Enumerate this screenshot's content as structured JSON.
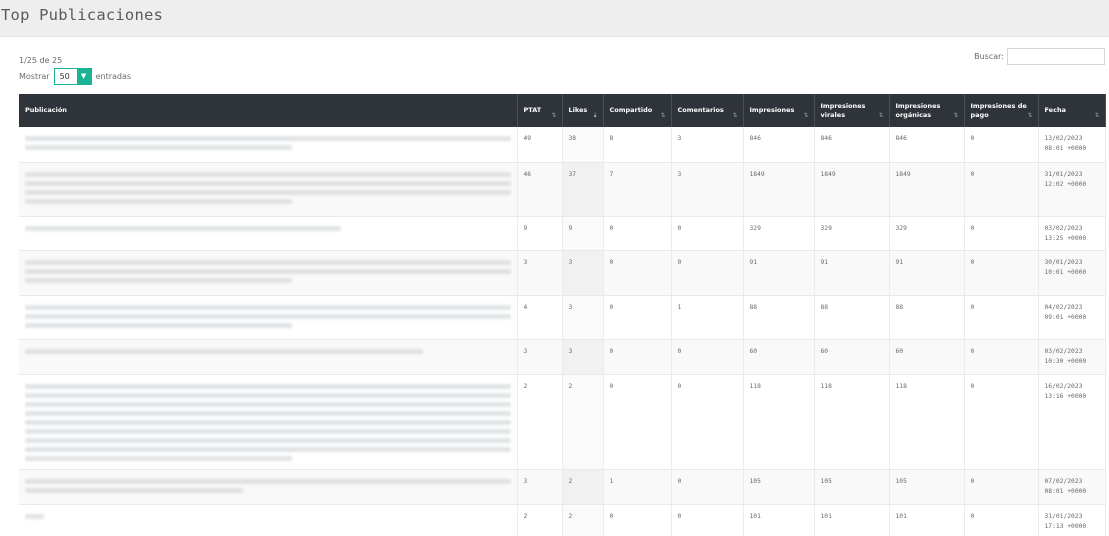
{
  "page": {
    "title": "Top Publicaciones"
  },
  "table_info": {
    "pagination_text": "1/25 de 25",
    "length_prefix": "Mostrar",
    "length_value": "50",
    "length_suffix": "entradas",
    "search_label": "Buscar:",
    "search_value": ""
  },
  "columns": [
    {
      "label": "Publicación",
      "sort": ""
    },
    {
      "label": "PTAT",
      "sort": "⇅"
    },
    {
      "label": "Likes",
      "sort": "⇣"
    },
    {
      "label": "Compartido",
      "sort": "⇅"
    },
    {
      "label": "Comentarios",
      "sort": "⇅"
    },
    {
      "label": "Impresiones",
      "sort": "⇅"
    },
    {
      "label": "Impresiones virales",
      "sort": "⇅"
    },
    {
      "label": "Impresiones orgánicas",
      "sort": "⇅"
    },
    {
      "label": "Impresiones de pago",
      "sort": "⇅"
    },
    {
      "label": "Fecha",
      "sort": "⇅"
    }
  ],
  "rows": [
    {
      "ptat": "49",
      "likes": "38",
      "shared": "8",
      "comments": "3",
      "impr": "846",
      "viral": "846",
      "organic": "846",
      "paid": "0",
      "date": "13/02/2023",
      "time": "08:01 +0000"
    },
    {
      "ptat": "46",
      "likes": "37",
      "shared": "7",
      "comments": "3",
      "impr": "1849",
      "viral": "1849",
      "organic": "1849",
      "paid": "0",
      "date": "31/01/2023",
      "time": "12:02 +0000"
    },
    {
      "ptat": "9",
      "likes": "9",
      "shared": "0",
      "comments": "0",
      "impr": "329",
      "viral": "329",
      "organic": "329",
      "paid": "0",
      "date": "03/02/2023",
      "time": "13:25 +0000"
    },
    {
      "ptat": "3",
      "likes": "3",
      "shared": "0",
      "comments": "0",
      "impr": "91",
      "viral": "91",
      "organic": "91",
      "paid": "0",
      "date": "30/01/2023",
      "time": "10:01 +0000"
    },
    {
      "ptat": "4",
      "likes": "3",
      "shared": "0",
      "comments": "1",
      "impr": "88",
      "viral": "88",
      "organic": "88",
      "paid": "0",
      "date": "04/02/2023",
      "time": "09:01 +0000"
    },
    {
      "ptat": "3",
      "likes": "3",
      "shared": "0",
      "comments": "0",
      "impr": "60",
      "viral": "60",
      "organic": "60",
      "paid": "0",
      "date": "03/02/2023",
      "time": "10:30 +0000"
    },
    {
      "ptat": "2",
      "likes": "2",
      "shared": "0",
      "comments": "0",
      "impr": "118",
      "viral": "118",
      "organic": "118",
      "paid": "0",
      "date": "16/02/2023",
      "time": "13:16 +0000"
    },
    {
      "ptat": "3",
      "likes": "2",
      "shared": "1",
      "comments": "0",
      "impr": "105",
      "viral": "105",
      "organic": "105",
      "paid": "0",
      "date": "07/02/2023",
      "time": "08:01 +0000"
    },
    {
      "ptat": "2",
      "likes": "2",
      "shared": "0",
      "comments": "0",
      "impr": "101",
      "viral": "101",
      "organic": "101",
      "paid": "0",
      "date": "31/01/2023",
      "time": "17:13 +0000"
    }
  ]
}
